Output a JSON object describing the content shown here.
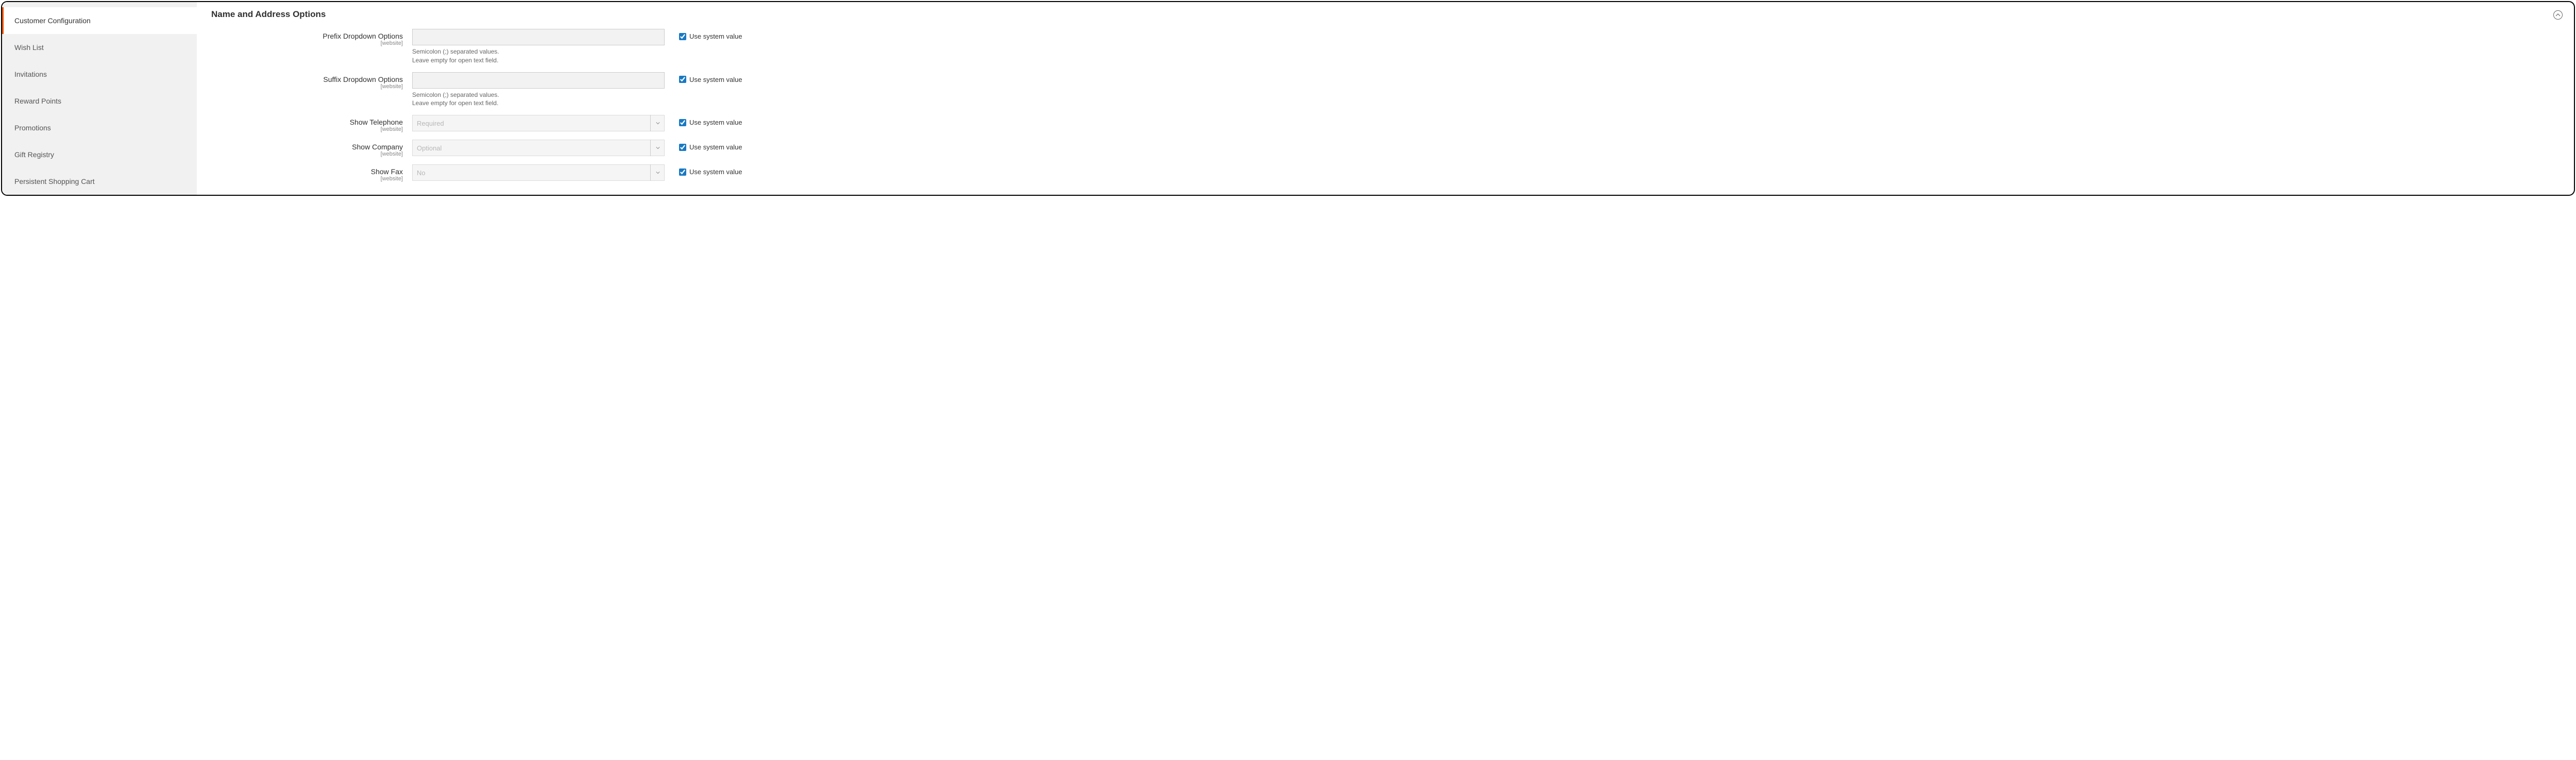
{
  "sidebar": {
    "items": [
      {
        "label": "Customer Configuration",
        "active": true
      },
      {
        "label": "Wish List",
        "active": false
      },
      {
        "label": "Invitations",
        "active": false
      },
      {
        "label": "Reward Points",
        "active": false
      },
      {
        "label": "Promotions",
        "active": false
      },
      {
        "label": "Gift Registry",
        "active": false
      },
      {
        "label": "Persistent Shopping Cart",
        "active": false
      }
    ]
  },
  "section": {
    "title": "Name and Address Options"
  },
  "scope_label": "[website]",
  "use_system_label": "Use system value",
  "fields": {
    "prefix": {
      "label": "Prefix Dropdown Options",
      "hint1": "Semicolon (;) separated values.",
      "hint2": "Leave empty for open text field.",
      "value": ""
    },
    "suffix": {
      "label": "Suffix Dropdown Options",
      "hint1": "Semicolon (;) separated values.",
      "hint2": "Leave empty for open text field.",
      "value": ""
    },
    "telephone": {
      "label": "Show Telephone",
      "value": "Required"
    },
    "company": {
      "label": "Show Company",
      "value": "Optional"
    },
    "fax": {
      "label": "Show Fax",
      "value": "No"
    }
  }
}
